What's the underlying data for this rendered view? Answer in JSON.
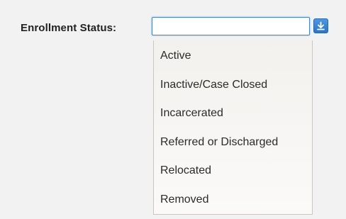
{
  "form": {
    "enrollment_status": {
      "label": "Enrollment Status:",
      "value": "",
      "button_icon": "download-arrow-icon",
      "accent_color": "#2b74c7",
      "options": [
        "Active",
        "Inactive/Case Closed",
        "Incarcerated",
        "Referred or Discharged",
        "Relocated",
        "Removed"
      ]
    }
  }
}
